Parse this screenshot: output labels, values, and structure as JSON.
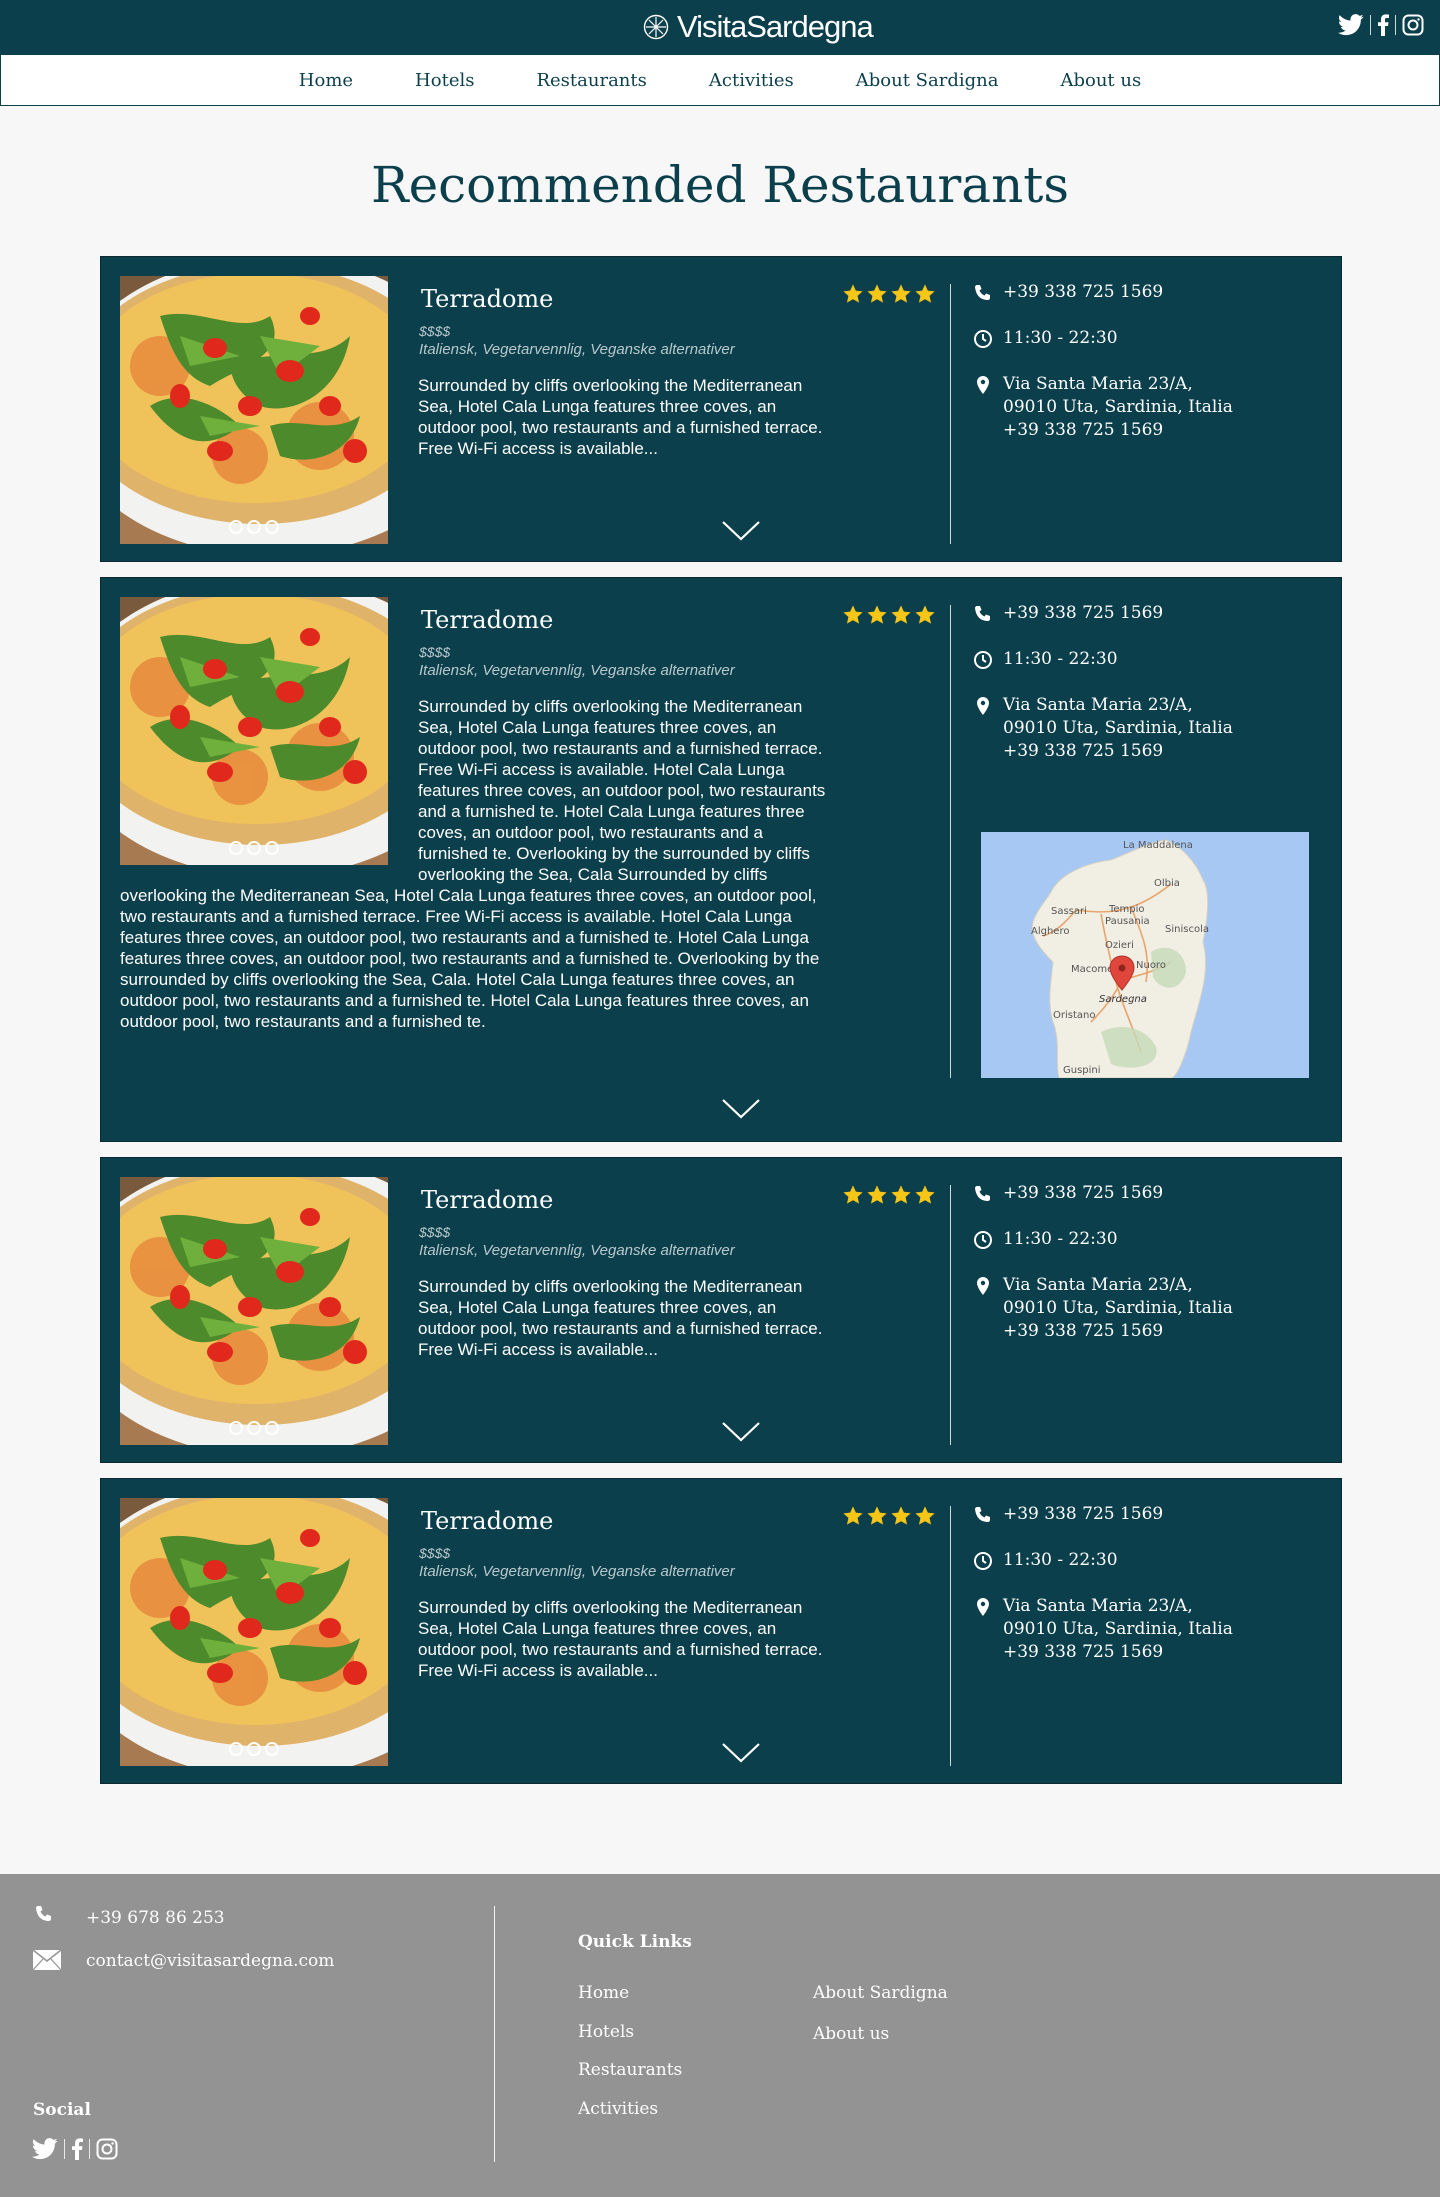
{
  "brand": {
    "name": "VisitaSardegna"
  },
  "nav": [
    "Home",
    "Hotels",
    "Restaurants",
    "Activities",
    "About Sardigna",
    "About us"
  ],
  "page": {
    "title": "Recommended Restaurants"
  },
  "colors": {
    "primary": "#0b3f4c",
    "footer": "#939393",
    "star": "#f5c518",
    "background": "#f7f7f7"
  },
  "restaurants": [
    {
      "name": "Terradome",
      "price": "$$$$",
      "cuisine": "Italiensk, Vegetarvennlig, Veganske alternativer",
      "rating": 4,
      "description": "Surrounded by cliffs overlooking the Mediterranean Sea, Hotel Cala Lunga features three coves, an outdoor pool, two restaurants and a furnished terrace. Free Wi-Fi access is available...",
      "phone": "+39 338 725 1569",
      "hours": "11:30 - 22:30",
      "address1": "Via Santa Maria 23/A,",
      "address2": "09010 Uta, Sardinia, Italia",
      "address_phone": "+39 338 725 1569"
    },
    {
      "name": "Terradome",
      "price": "$$$$",
      "cuisine": "Italiensk, Vegetarvennlig, Veganske alternativer",
      "rating": 4,
      "description": "Surrounded by cliffs overlooking the Mediterranean Sea, Hotel Cala Lunga features three coves, an outdoor pool, two restaurants and a furnished terrace. Free Wi-Fi access is available. Hotel Cala Lunga features three coves, an outdoor pool, two restaurants and a furnished te. Hotel Cala Lunga features three coves, an outdoor pool, two restaurants and a furnished te. Overlooking by the surrounded by cliffs overlooking the Sea, Cala Surrounded by cliffs overlooking the Mediterranean Sea, Hotel Cala Lunga features three coves, an outdoor pool, two restaurants and a furnished terrace. Free Wi-Fi access is available. Hotel Cala Lunga features three coves, an outdoor pool, two restaurants and a furnished te. Hotel Cala Lunga features three coves, an outdoor pool, two restaurants and a furnished te. Overlooking by the surrounded by cliffs overlooking the Sea, Cala.  Hotel Cala Lunga features three coves, an outdoor pool, two restaurants and a furnished te. Hotel Cala Lunga features three coves, an outdoor pool, two restaurants and a furnished te.",
      "phone": "+39 338 725 1569",
      "hours": "11:30 - 22:30",
      "address1": "Via Santa Maria 23/A,",
      "address2": "09010 Uta, Sardinia, Italia",
      "address_phone": "+39 338 725 1569",
      "map": {
        "labels": [
          "La Maddalena",
          "Olbia",
          "Sassari",
          "Tempio",
          "Pausania",
          "Alghero",
          "Siniscola",
          "Ozieri",
          "Nuoro",
          "Macomer",
          "Sardegna",
          "Oristano",
          "Guspini"
        ]
      }
    },
    {
      "name": "Terradome",
      "price": "$$$$",
      "cuisine": "Italiensk, Vegetarvennlig, Veganske alternativer",
      "rating": 4,
      "description": "Surrounded by cliffs overlooking the Mediterranean Sea, Hotel Cala Lunga features three coves, an outdoor pool, two restaurants and a furnished terrace. Free Wi-Fi access is available...",
      "phone": "+39 338 725 1569",
      "hours": "11:30 - 22:30",
      "address1": "Via Santa Maria 23/A,",
      "address2": "09010 Uta, Sardinia, Italia",
      "address_phone": "+39 338 725 1569"
    },
    {
      "name": "Terradome",
      "price": "$$$$",
      "cuisine": "Italiensk, Vegetarvennlig, Veganske alternativer",
      "rating": 4,
      "description": "Surrounded by cliffs overlooking the Mediterranean Sea, Hotel Cala Lunga features three coves, an outdoor pool, two restaurants and a furnished terrace. Free Wi-Fi access is available...",
      "phone": "+39 338 725 1569",
      "hours": "11:30 - 22:30",
      "address1": "Via Santa Maria 23/A,",
      "address2": "09010 Uta, Sardinia, Italia",
      "address_phone": "+39 338 725 1569"
    }
  ],
  "footer": {
    "phone": "+39 678 86 253",
    "email": "contact@visitasardegna.com",
    "social_title": "Social",
    "quick_links_title": "Quick Links",
    "links": [
      "Home",
      "Hotels",
      "Restaurants",
      "Activities",
      "About Sardigna",
      "About us"
    ]
  },
  "icons": {
    "social": [
      "twitter-icon",
      "facebook-icon",
      "instagram-icon"
    ],
    "info": [
      "phone-icon",
      "clock-icon",
      "map-pin-icon"
    ]
  }
}
